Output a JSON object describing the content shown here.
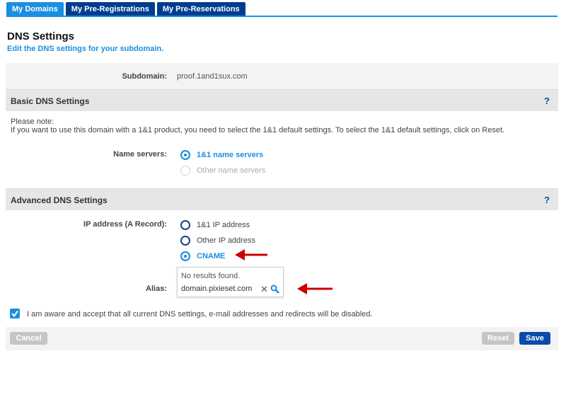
{
  "tabs": [
    {
      "label": "My Domains",
      "active": true
    },
    {
      "label": "My Pre-Registrations",
      "active": false
    },
    {
      "label": "My Pre-Reservations",
      "active": false
    }
  ],
  "page": {
    "title": "DNS Settings",
    "subtitle": "Edit the DNS settings for your subdomain."
  },
  "subdomain": {
    "label": "Subdomain:",
    "value": "proof.1and1sux.com"
  },
  "basic": {
    "header": "Basic DNS Settings",
    "help": "?",
    "note_line1": "Please note:",
    "note_line2": "If you want to use this domain with a 1&1 product, you need to select the 1&1 default settings. To select the 1&1 default settings, click on Reset.",
    "name_servers_label": "Name servers:",
    "options": [
      {
        "label": "1&1 name servers",
        "selected": true
      },
      {
        "label": "Other name servers",
        "selected": false,
        "disabled": true
      }
    ]
  },
  "advanced": {
    "header": "Advanced DNS Settings",
    "help": "?",
    "ip_label": "IP address (A Record):",
    "options": [
      {
        "label": "1&1 IP address",
        "selected": false
      },
      {
        "label": "Other IP address",
        "selected": false
      },
      {
        "label": "CNAME",
        "selected": true
      }
    ],
    "alias_label": "Alias:",
    "alias_no_results": "No results found.",
    "alias_value": "domain.pixieset.com",
    "clear_glyph": "✕"
  },
  "agreement": {
    "checked": true,
    "text": "I am aware and accept that all current DNS settings, e-mail addresses and redirects will be disabled."
  },
  "buttons": {
    "cancel": "Cancel",
    "reset": "Reset",
    "save": "Save"
  },
  "colors": {
    "accent": "#1a8fe0",
    "tab_dark": "#003d8f",
    "save": "#0a4aa8",
    "arrow": "#cc0000"
  }
}
